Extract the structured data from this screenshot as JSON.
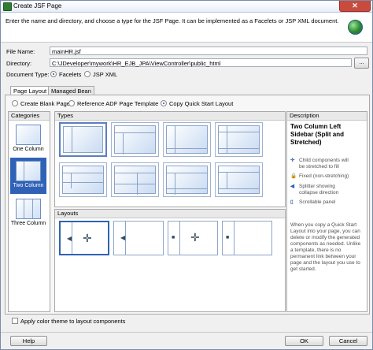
{
  "window": {
    "title": "Create JSF Page",
    "close_glyph": "✕"
  },
  "header": {
    "description": "Enter the name and directory, and choose a type for the JSF Page. It can be implemented as a Facelets or JSP XML document."
  },
  "form": {
    "file_name_label": "File Name:",
    "file_name_value": "mainHR.jsf",
    "directory_label": "Directory:",
    "directory_value": "C:\\JDeveloper\\mywork\\HR_EJB_JPA\\ViewController\\public_html",
    "browse_label": "...",
    "document_type_label": "Document Type:",
    "doc_type_options": [
      "Facelets",
      "JSP XML"
    ],
    "doc_type_selected": "Facelets"
  },
  "tabs": [
    "Page Layout",
    "Managed Bean"
  ],
  "layout_options": {
    "items": [
      "Create Blank Page",
      "Reference ADF Page Template",
      "Copy Quick Start Layout"
    ],
    "selected": "Copy Quick Start Layout"
  },
  "categories": {
    "title": "Categories",
    "items": [
      "One Column",
      "Two Column",
      "Three Column"
    ],
    "selected": "Two Column"
  },
  "types": {
    "title": "Types"
  },
  "layouts": {
    "title": "Layouts"
  },
  "description": {
    "title": "Description",
    "heading": "Two Column Left Sidebar (Split and Stretched)",
    "legend": [
      {
        "icon": "stretch-icon",
        "glyph": "✛",
        "text": "Child components will be stretched to fill"
      },
      {
        "icon": "fixed-icon",
        "glyph": "🔒",
        "text": "Fixed (non-stretching)"
      },
      {
        "icon": "splitter-icon",
        "glyph": "◀",
        "text": "Splitter showing collapse direction"
      },
      {
        "icon": "scrollable-icon",
        "glyph": "▯",
        "text": "Scrollable panel"
      }
    ],
    "body": "When you copy a Quick Start Layout into your page, you can delete or modify the generated components as needed. Unlike a template, there is no permanent link between your page and the layout you use to get started."
  },
  "footer": {
    "apply_color_theme_label": "Apply color theme to layout components",
    "help_label": "Help",
    "ok_label": "OK",
    "cancel_label": "Cancel"
  },
  "colors": {
    "accent": "#2f62b7",
    "frame": "#7a8ca8"
  }
}
